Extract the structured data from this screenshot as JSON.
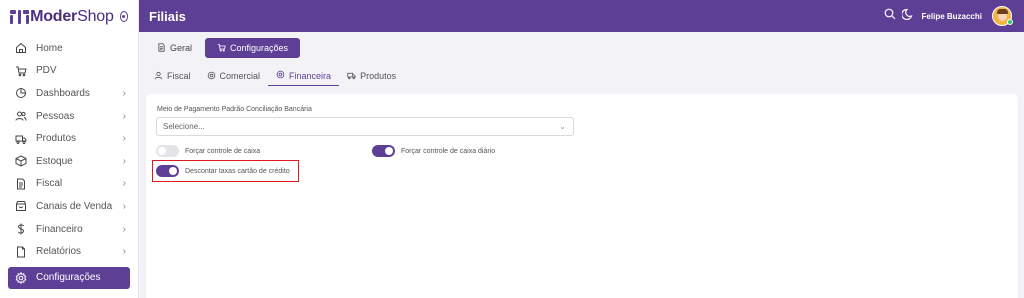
{
  "brand": {
    "name_bold": "Moder",
    "name_light": "Shop"
  },
  "sidebar": {
    "items": [
      {
        "label": "Home",
        "icon": "home-icon",
        "has_chevron": false
      },
      {
        "label": "PDV",
        "icon": "cart-icon",
        "has_chevron": false
      },
      {
        "label": "Dashboards",
        "icon": "pie-chart-icon",
        "has_chevron": true
      },
      {
        "label": "Pessoas",
        "icon": "users-icon",
        "has_chevron": true
      },
      {
        "label": "Produtos",
        "icon": "truck-icon",
        "has_chevron": true
      },
      {
        "label": "Estoque",
        "icon": "box-icon",
        "has_chevron": true
      },
      {
        "label": "Fiscal",
        "icon": "document-icon",
        "has_chevron": true
      },
      {
        "label": "Canais de Venda",
        "icon": "store-icon",
        "has_chevron": true
      },
      {
        "label": "Financeiro",
        "icon": "dollar-icon",
        "has_chevron": true
      },
      {
        "label": "Relatórios",
        "icon": "file-icon",
        "has_chevron": true
      },
      {
        "label": "Configurações",
        "icon": "gear-icon",
        "has_chevron": false,
        "active": true
      }
    ]
  },
  "header": {
    "title": "Filiais",
    "user_name": "Felipe Buzacchi"
  },
  "tabs_top": [
    {
      "label": "Geral",
      "icon": "document-icon",
      "active": false
    },
    {
      "label": "Configurações",
      "icon": "cart-icon",
      "active": true
    }
  ],
  "tabs_sub": [
    {
      "label": "Fiscal",
      "icon": "user-icon",
      "active": false
    },
    {
      "label": "Comercial",
      "icon": "gear-icon",
      "active": false
    },
    {
      "label": "Financeira",
      "icon": "gear-icon",
      "active": true
    },
    {
      "label": "Produtos",
      "icon": "truck-icon",
      "active": false
    }
  ],
  "form": {
    "payment_label": "Meio de Pagamento Padrão Conciliação Bancária",
    "payment_placeholder": "Selecione...",
    "toggle_force_cash": "Forçar controle de caixa",
    "toggle_force_cash_on": false,
    "toggle_force_daily": "Forçar controle de caixa diário",
    "toggle_force_daily_on": true,
    "toggle_discount_fees": "Descontar taxas cartão de crédito",
    "toggle_discount_fees_on": true
  },
  "colors": {
    "primary": "#5e3f96",
    "highlight": "#e0191f"
  }
}
